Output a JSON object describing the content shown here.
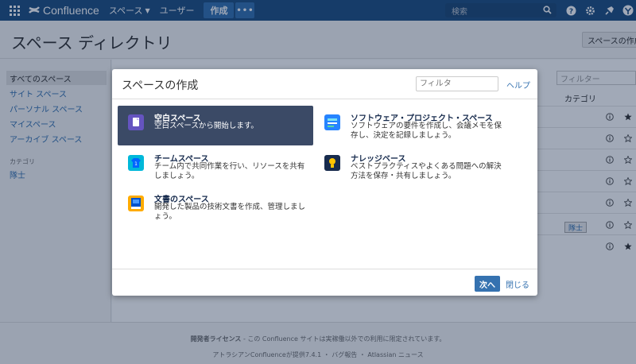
{
  "topnav": {
    "brand": "Confluence",
    "spaces_label": "スペース",
    "users_label": "ユーザー",
    "create_label": "作成",
    "more_label": "•••",
    "search_placeholder": "検索",
    "bg_color": "#205081"
  },
  "page": {
    "title": "スペース ディレクトリ",
    "space_dir_button": "スペースの作成",
    "filter_placeholder": "フィルター",
    "category_header": "カテゴリ",
    "row_tag": "隊士"
  },
  "sidebar": {
    "items": [
      {
        "label": "すべてのスペース",
        "active": true
      },
      {
        "label": "サイト スペース",
        "active": false
      },
      {
        "label": "パーソナル スペース",
        "active": false
      },
      {
        "label": "マイスペース",
        "active": false
      },
      {
        "label": "アーカイブ スペース",
        "active": false
      }
    ],
    "category_heading": "カテゴリ",
    "category_item": "隊士"
  },
  "dialog": {
    "title": "スペースの作成",
    "filter_placeholder": "フィルタ",
    "help_label": "ヘルプ",
    "blueprints": [
      {
        "name": "空白スペース",
        "desc": "空白スペースから開始します。",
        "icon": "blank-space-icon",
        "selected": true
      },
      {
        "name": "ソフトウェア・プロジェクト・スペース",
        "desc": "ソフトウェアの要件を作成し、会議メモを保存し、決定を記録しましょう。",
        "icon": "software-project-icon",
        "selected": false
      },
      {
        "name": "チームスペース",
        "desc": "チーム内で共同作業を行い、リソースを共有しましょう。",
        "icon": "team-space-icon",
        "selected": false
      },
      {
        "name": "ナレッジベース",
        "desc": "ベストプラクティスやよくある問題への解決方法を保存・共有しましょう。",
        "icon": "knowledge-base-icon",
        "selected": false
      },
      {
        "name": "文書のスペース",
        "desc": "開発した製品の技術文書を作成、管理しましょう。",
        "icon": "documentation-space-icon",
        "selected": false
      }
    ],
    "next_label": "次へ",
    "close_label": "閉じる"
  },
  "footer": {
    "license_bold": "開発者ライセンス",
    "license_text": " - この Confluence サイトは実稼働以外での利用に限定されています。",
    "powered": "アトラシアンConfluenceが提供7.4.1 ・ バグ報告 ・ Atlassian ニュース"
  }
}
